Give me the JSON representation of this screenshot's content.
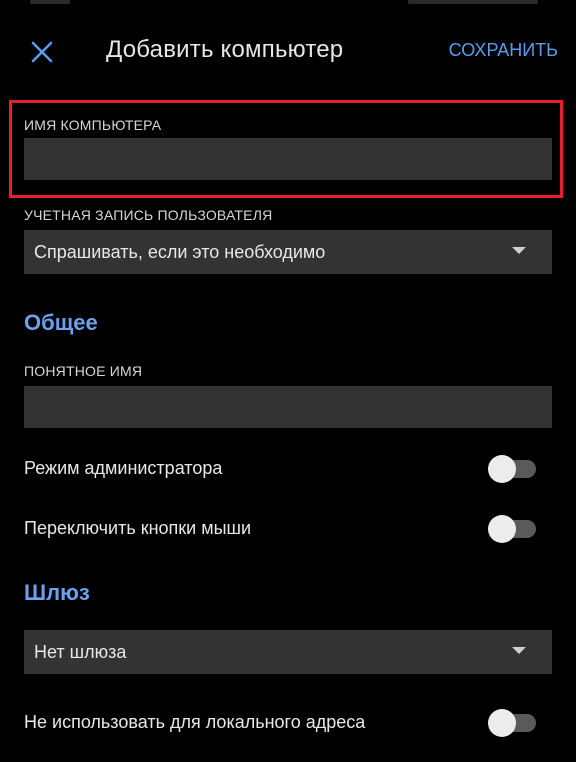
{
  "header": {
    "title": "Добавить компьютер",
    "save_label": "СОХРАНИТЬ",
    "close_icon": "close-icon"
  },
  "computer_name": {
    "label": "ИМЯ КОМПЬЮТЕРА",
    "value": "",
    "highlighted": true,
    "highlight_color": "#e5202a"
  },
  "user_account": {
    "label": "УЧЕТНАЯ ЗАПИСЬ ПОЛЬЗОВАТЕЛЯ",
    "selected": "Спрашивать, если это необходимо"
  },
  "general": {
    "header": "Общее",
    "friendly_name": {
      "label": "ПОНЯТНОЕ ИМЯ",
      "value": ""
    },
    "admin_mode": {
      "label": "Режим администратора",
      "on": false
    },
    "swap_mouse": {
      "label": "Переключить кнопки мыши",
      "on": false
    }
  },
  "gateway": {
    "header": "Шлюз",
    "selected": "Нет шлюза",
    "bypass_local": {
      "label": "Не использовать для локального адреса",
      "on": false
    }
  },
  "colors": {
    "background": "#000000",
    "accent": "#5b9bf0",
    "field_background": "#333333",
    "highlight": "#e5202a"
  }
}
